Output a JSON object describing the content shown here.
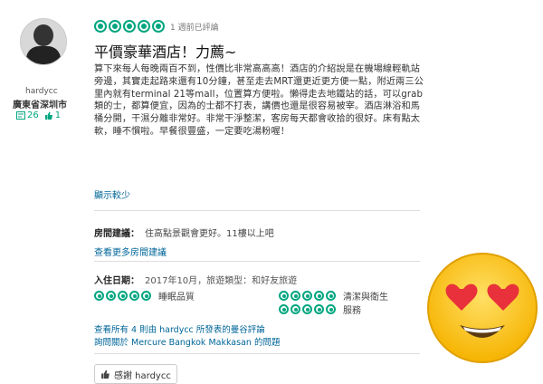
{
  "user": {
    "name": "hardycc",
    "location": "廣東省深圳市",
    "reviews_count": "26",
    "helpful_count": "1"
  },
  "review": {
    "rating": 5,
    "date": "1 週前已評論",
    "title": "平價豪華酒店！力薦~",
    "body": "算下來每人每晚兩百不到，性價比非常高高高！酒店的介紹說是在機場線輕軌站旁邊，其實走起路來還有10分鐘，甚至走去MRT還更近更方便一點，附近兩三公里內就有terminal 21等mall，位置算方便啦。懶得走去地鐵站的話，可以grab類的士，都算便宜，因為的士都不打表，講價也還是很容易被宰。酒店淋浴和馬桶分開，干濕分離非常好。非常干淨整潔，客房每天都會收拾的很好。床有點太軟，睡不慣啦。早餐很豐盛，一定要吃湯粉喔！",
    "show_less": "顯示較少",
    "room_tip_label": "房間建議：",
    "room_tip_text": "住高點景觀會更好。11樓以上吧",
    "more_room_tips": "查看更多房間建議",
    "stay_label": "入住日期：",
    "stay_text": "2017年10月，旅遊類型：和好友旅遊",
    "sub_ratings": [
      {
        "label": "睡眠品質",
        "rating": 5
      },
      {
        "label": "清潔與衛生",
        "rating": 5
      },
      {
        "label": "服務",
        "rating": 5
      }
    ],
    "see_all_reviews": "查看所有 4 則由 hardycc 所發表的曼谷評論",
    "ask_about": "詢問關於 Mercure Bangkok Makkasan 的問題",
    "thanks_label": "感謝 hardycc"
  },
  "colors": {
    "accent": "#00a680",
    "link": "#006699"
  },
  "icons": {
    "avatar": "user-avatar",
    "emoji": "heart-eyes-emoji"
  }
}
